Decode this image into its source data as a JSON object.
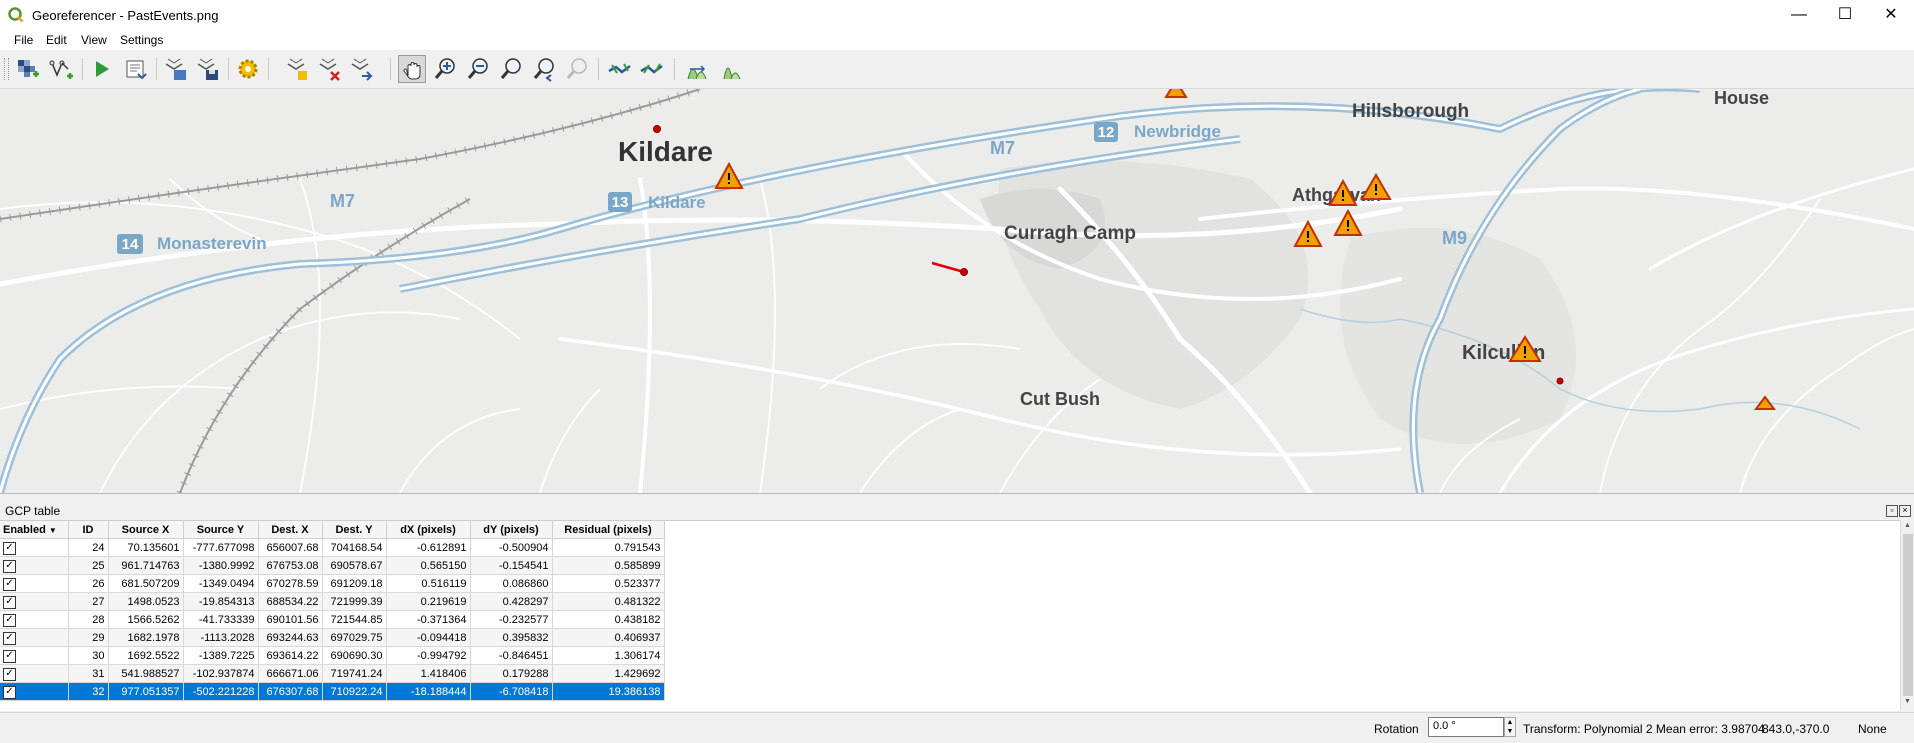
{
  "window": {
    "title": "Georeferencer - PastEvents.png",
    "minimize": "—",
    "maximize": "☐",
    "close": "✕"
  },
  "menu": [
    "File",
    "Edit",
    "View",
    "Settings"
  ],
  "toolbar_icons": [
    "open-raster-icon",
    "start-georeferencing-icon",
    "generate-gdal-script-icon",
    "load-gcp-points-icon",
    "save-gcp-points-icon",
    "transformation-settings-icon",
    "add-point-icon",
    "delete-point-icon",
    "move-gcp-point-icon",
    "pan-icon",
    "zoom-in-icon",
    "zoom-out-icon",
    "zoom-to-layer-icon",
    "zoom-last-icon",
    "zoom-next-icon",
    "link-georeferencer-to-qgis-icon",
    "link-qgis-to-georeferencer-icon",
    "full-histogram-stretch-icon",
    "local-histogram-stretch-icon"
  ],
  "map": {
    "labels": {
      "kildare": "Kildare",
      "kildare_exit": "Kildare",
      "exit13": "13",
      "exit12": "12",
      "newbridge": "Newbridge",
      "exit14": "14",
      "monasterevin": "Monasterevin",
      "m7a": "M7",
      "m7b": "M7",
      "m9": "M9",
      "curragh": "Curragh Camp",
      "hillsborough": "Hillsborough",
      "athgarvan": "Athgarvan",
      "kilcullen": "Kilcullen",
      "cutbush": "Cut Bush",
      "house": "House"
    },
    "colors": {
      "background": "#ecedeb",
      "road": "#ffffff",
      "motorway": "#9ec1d9",
      "label": "#333333",
      "motorway_label": "#7aa7c7",
      "gcp_point": "#cc0000",
      "warning_fill": "#f0a000",
      "warning_stroke": "#c03000"
    }
  },
  "gcp_table": {
    "title": "GCP table",
    "columns": [
      "Enabled",
      "ID",
      "Source X",
      "Source Y",
      "Dest. X",
      "Dest. Y",
      "dX (pixels)",
      "dY (pixels)",
      "Residual (pixels)"
    ],
    "rows": [
      {
        "enabled": "✓",
        "id": "24",
        "sx": "70.135601",
        "sy": "-777.677098",
        "dx": "656007.68",
        "dy": "704168.54",
        "px": "-0.612891",
        "py": "-0.500904",
        "res": "0.791543"
      },
      {
        "enabled": "✓",
        "id": "25",
        "sx": "961.714763",
        "sy": "-1380.9992",
        "dx": "676753.08",
        "dy": "690578.67",
        "px": "0.565150",
        "py": "-0.154541",
        "res": "0.585899"
      },
      {
        "enabled": "✓",
        "id": "26",
        "sx": "681.507209",
        "sy": "-1349.0494",
        "dx": "670278.59",
        "dy": "691209.18",
        "px": "0.516119",
        "py": "0.086860",
        "res": "0.523377"
      },
      {
        "enabled": "✓",
        "id": "27",
        "sx": "1498.0523",
        "sy": "-19.854313",
        "dx": "688534.22",
        "dy": "721999.39",
        "px": "0.219619",
        "py": "0.428297",
        "res": "0.481322"
      },
      {
        "enabled": "✓",
        "id": "28",
        "sx": "1566.5262",
        "sy": "-41.733339",
        "dx": "690101.56",
        "dy": "721544.85",
        "px": "-0.371364",
        "py": "-0.232577",
        "res": "0.438182"
      },
      {
        "enabled": "✓",
        "id": "29",
        "sx": "1682.1978",
        "sy": "-1113.2028",
        "dx": "693244.63",
        "dy": "697029.75",
        "px": "-0.094418",
        "py": "0.395832",
        "res": "0.406937"
      },
      {
        "enabled": "✓",
        "id": "30",
        "sx": "1692.5522",
        "sy": "-1389.7225",
        "dx": "693614.22",
        "dy": "690690.30",
        "px": "-0.994792",
        "py": "-0.846451",
        "res": "1.306174"
      },
      {
        "enabled": "✓",
        "id": "31",
        "sx": "541.988527",
        "sy": "-102.937874",
        "dx": "666671.06",
        "dy": "719741.24",
        "px": "1.418406",
        "py": "0.179288",
        "res": "1.429692"
      },
      {
        "enabled": "✓",
        "id": "32",
        "sx": "977.051357",
        "sy": "-502.221228",
        "dx": "676307.68",
        "dy": "710922.24",
        "px": "-18.188444",
        "py": "-6.708418",
        "res": "19.386138"
      }
    ]
  },
  "status": {
    "rotation_label": "Rotation",
    "rotation_value": "0.0 °",
    "transform": "Transform: Polynomial 2 Mean error: 3.98704",
    "coords": "843.0,-370.0",
    "crs": "None"
  }
}
